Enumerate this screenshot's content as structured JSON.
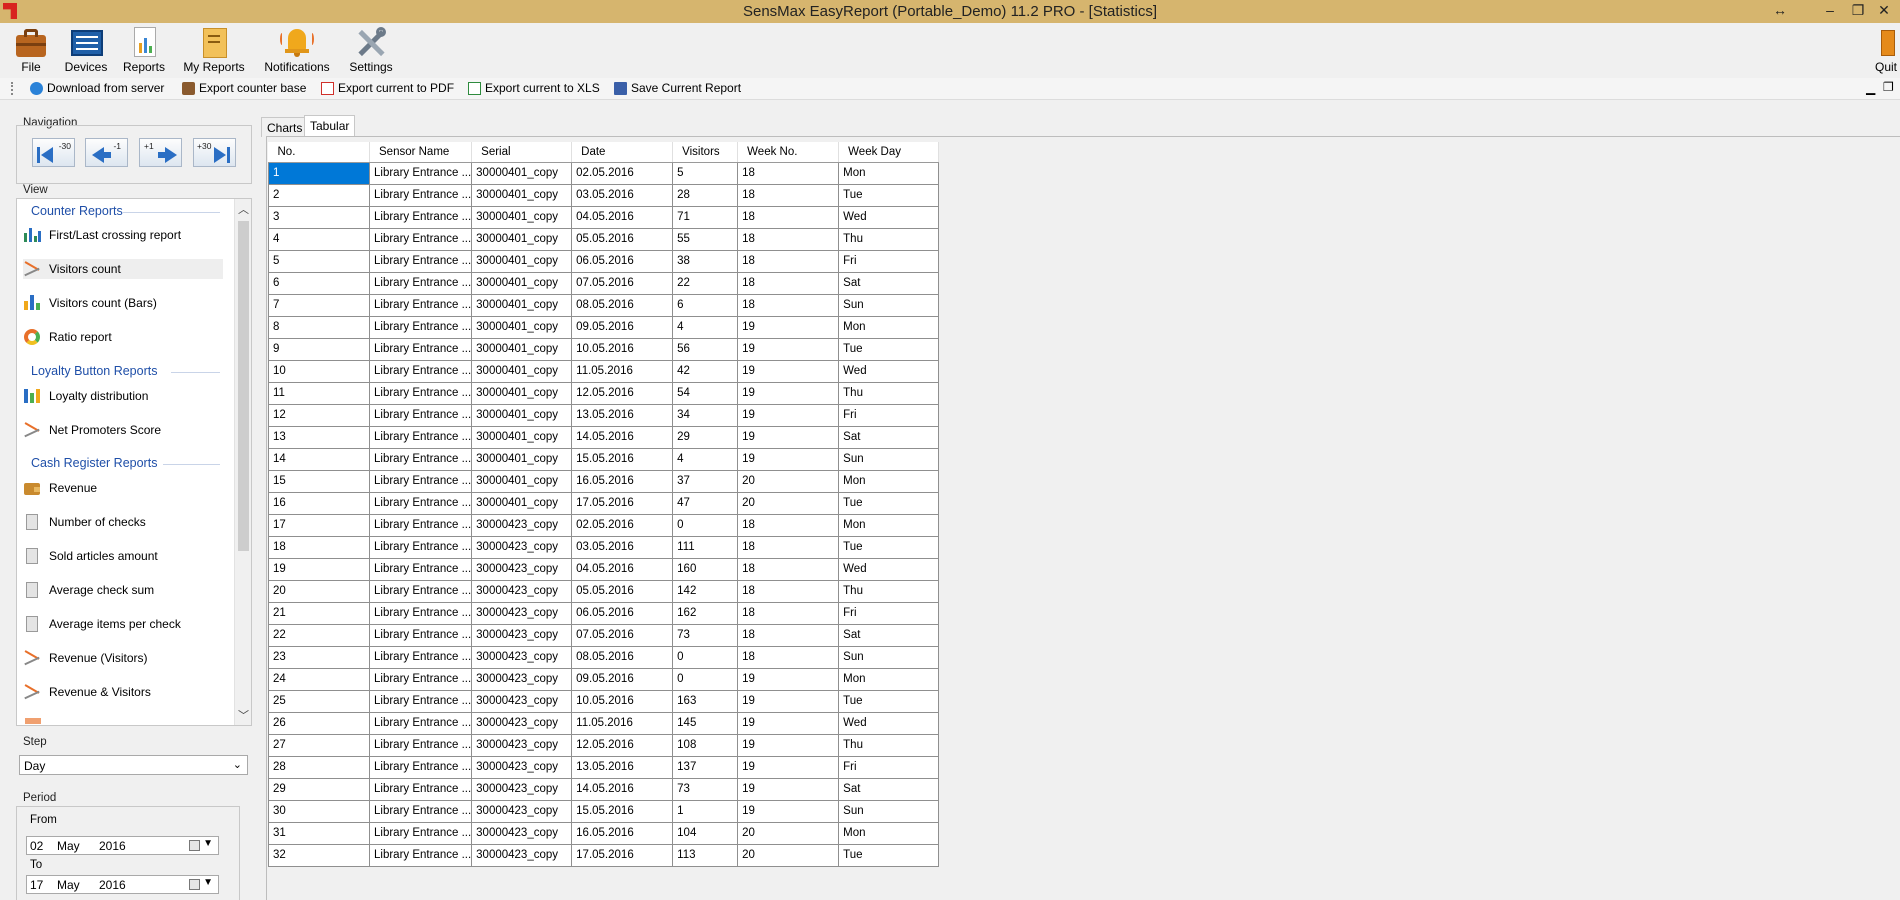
{
  "window": {
    "title": "SensMax EasyReport (Portable_Demo) 11.2 PRO - [Statistics]"
  },
  "ribbon": {
    "file": "File",
    "devices": "Devices",
    "reports": "Reports",
    "my_reports": "My Reports",
    "notifications": "Notifications",
    "settings": "Settings",
    "quit": "Quit"
  },
  "toolbar": {
    "download": "Download from server",
    "export_base": "Export counter base",
    "export_pdf": "Export current to PDF",
    "export_xls": "Export current to XLS",
    "save_report": "Save Current Report"
  },
  "navigation": {
    "label": "Navigation",
    "back30": "-30",
    "back1": "-1",
    "fwd1": "+1",
    "fwd30": "+30"
  },
  "view": {
    "label": "View",
    "sections": {
      "counter": "Counter Reports",
      "loyalty": "Loyalty Button Reports",
      "cash": "Cash Register Reports"
    },
    "items": {
      "first_last": "First/Last crossing report",
      "visitors_count": "Visitors count",
      "visitors_bars": "Visitors count (Bars)",
      "ratio": "Ratio report",
      "loyalty_dist": "Loyalty distribution",
      "nps": "Net Promoters Score",
      "revenue": "Revenue",
      "num_checks": "Number of checks",
      "sold_articles": "Sold articles amount",
      "avg_check": "Average check sum",
      "avg_items": "Average items per check",
      "revenue_visitors": "Revenue (Visitors)",
      "revenue_and_visitors": "Revenue & Visitors"
    }
  },
  "step": {
    "label": "Step",
    "value": "Day"
  },
  "period": {
    "label": "Period",
    "from_label": "From",
    "from": {
      "day": "02",
      "month": "May",
      "year": "2016"
    },
    "to_label": "To",
    "to": {
      "day": "17",
      "month": "May",
      "year": "2016"
    }
  },
  "tabs": {
    "charts": "Charts",
    "tabular": "Tabular"
  },
  "table": {
    "columns": [
      "No.",
      "Sensor Name",
      "Serial",
      "Date",
      "Visitors",
      "Week No.",
      "Week Day"
    ],
    "rows": [
      [
        "1",
        "Library Entrance ...",
        "30000401_copy",
        "02.05.2016",
        "5",
        "18",
        "Mon"
      ],
      [
        "2",
        "Library Entrance ...",
        "30000401_copy",
        "03.05.2016",
        "28",
        "18",
        "Tue"
      ],
      [
        "3",
        "Library Entrance ...",
        "30000401_copy",
        "04.05.2016",
        "71",
        "18",
        "Wed"
      ],
      [
        "4",
        "Library Entrance ...",
        "30000401_copy",
        "05.05.2016",
        "55",
        "18",
        "Thu"
      ],
      [
        "5",
        "Library Entrance ...",
        "30000401_copy",
        "06.05.2016",
        "38",
        "18",
        "Fri"
      ],
      [
        "6",
        "Library Entrance ...",
        "30000401_copy",
        "07.05.2016",
        "22",
        "18",
        "Sat"
      ],
      [
        "7",
        "Library Entrance ...",
        "30000401_copy",
        "08.05.2016",
        "6",
        "18",
        "Sun"
      ],
      [
        "8",
        "Library Entrance ...",
        "30000401_copy",
        "09.05.2016",
        "4",
        "19",
        "Mon"
      ],
      [
        "9",
        "Library Entrance ...",
        "30000401_copy",
        "10.05.2016",
        "56",
        "19",
        "Tue"
      ],
      [
        "10",
        "Library Entrance ...",
        "30000401_copy",
        "11.05.2016",
        "42",
        "19",
        "Wed"
      ],
      [
        "11",
        "Library Entrance ...",
        "30000401_copy",
        "12.05.2016",
        "54",
        "19",
        "Thu"
      ],
      [
        "12",
        "Library Entrance ...",
        "30000401_copy",
        "13.05.2016",
        "34",
        "19",
        "Fri"
      ],
      [
        "13",
        "Library Entrance ...",
        "30000401_copy",
        "14.05.2016",
        "29",
        "19",
        "Sat"
      ],
      [
        "14",
        "Library Entrance ...",
        "30000401_copy",
        "15.05.2016",
        "4",
        "19",
        "Sun"
      ],
      [
        "15",
        "Library Entrance ...",
        "30000401_copy",
        "16.05.2016",
        "37",
        "20",
        "Mon"
      ],
      [
        "16",
        "Library Entrance ...",
        "30000401_copy",
        "17.05.2016",
        "47",
        "20",
        "Tue"
      ],
      [
        "17",
        "Library Entrance ...",
        "30000423_copy",
        "02.05.2016",
        "0",
        "18",
        "Mon"
      ],
      [
        "18",
        "Library Entrance ...",
        "30000423_copy",
        "03.05.2016",
        "111",
        "18",
        "Tue"
      ],
      [
        "19",
        "Library Entrance ...",
        "30000423_copy",
        "04.05.2016",
        "160",
        "18",
        "Wed"
      ],
      [
        "20",
        "Library Entrance ...",
        "30000423_copy",
        "05.05.2016",
        "142",
        "18",
        "Thu"
      ],
      [
        "21",
        "Library Entrance ...",
        "30000423_copy",
        "06.05.2016",
        "162",
        "18",
        "Fri"
      ],
      [
        "22",
        "Library Entrance ...",
        "30000423_copy",
        "07.05.2016",
        "73",
        "18",
        "Sat"
      ],
      [
        "23",
        "Library Entrance ...",
        "30000423_copy",
        "08.05.2016",
        "0",
        "18",
        "Sun"
      ],
      [
        "24",
        "Library Entrance ...",
        "30000423_copy",
        "09.05.2016",
        "0",
        "19",
        "Mon"
      ],
      [
        "25",
        "Library Entrance ...",
        "30000423_copy",
        "10.05.2016",
        "163",
        "19",
        "Tue"
      ],
      [
        "26",
        "Library Entrance ...",
        "30000423_copy",
        "11.05.2016",
        "145",
        "19",
        "Wed"
      ],
      [
        "27",
        "Library Entrance ...",
        "30000423_copy",
        "12.05.2016",
        "108",
        "19",
        "Thu"
      ],
      [
        "28",
        "Library Entrance ...",
        "30000423_copy",
        "13.05.2016",
        "137",
        "19",
        "Fri"
      ],
      [
        "29",
        "Library Entrance ...",
        "30000423_copy",
        "14.05.2016",
        "73",
        "19",
        "Sat"
      ],
      [
        "30",
        "Library Entrance ...",
        "30000423_copy",
        "15.05.2016",
        "1",
        "19",
        "Sun"
      ],
      [
        "31",
        "Library Entrance ...",
        "30000423_copy",
        "16.05.2016",
        "104",
        "20",
        "Mon"
      ],
      [
        "32",
        "Library Entrance ...",
        "30000423_copy",
        "17.05.2016",
        "113",
        "20",
        "Tue"
      ]
    ]
  },
  "colors": {
    "titlebar": "#d6b56e",
    "section_header": "#1f4fa8",
    "selection": "#0078d7",
    "nav_arrow": "#2a6ec4"
  }
}
